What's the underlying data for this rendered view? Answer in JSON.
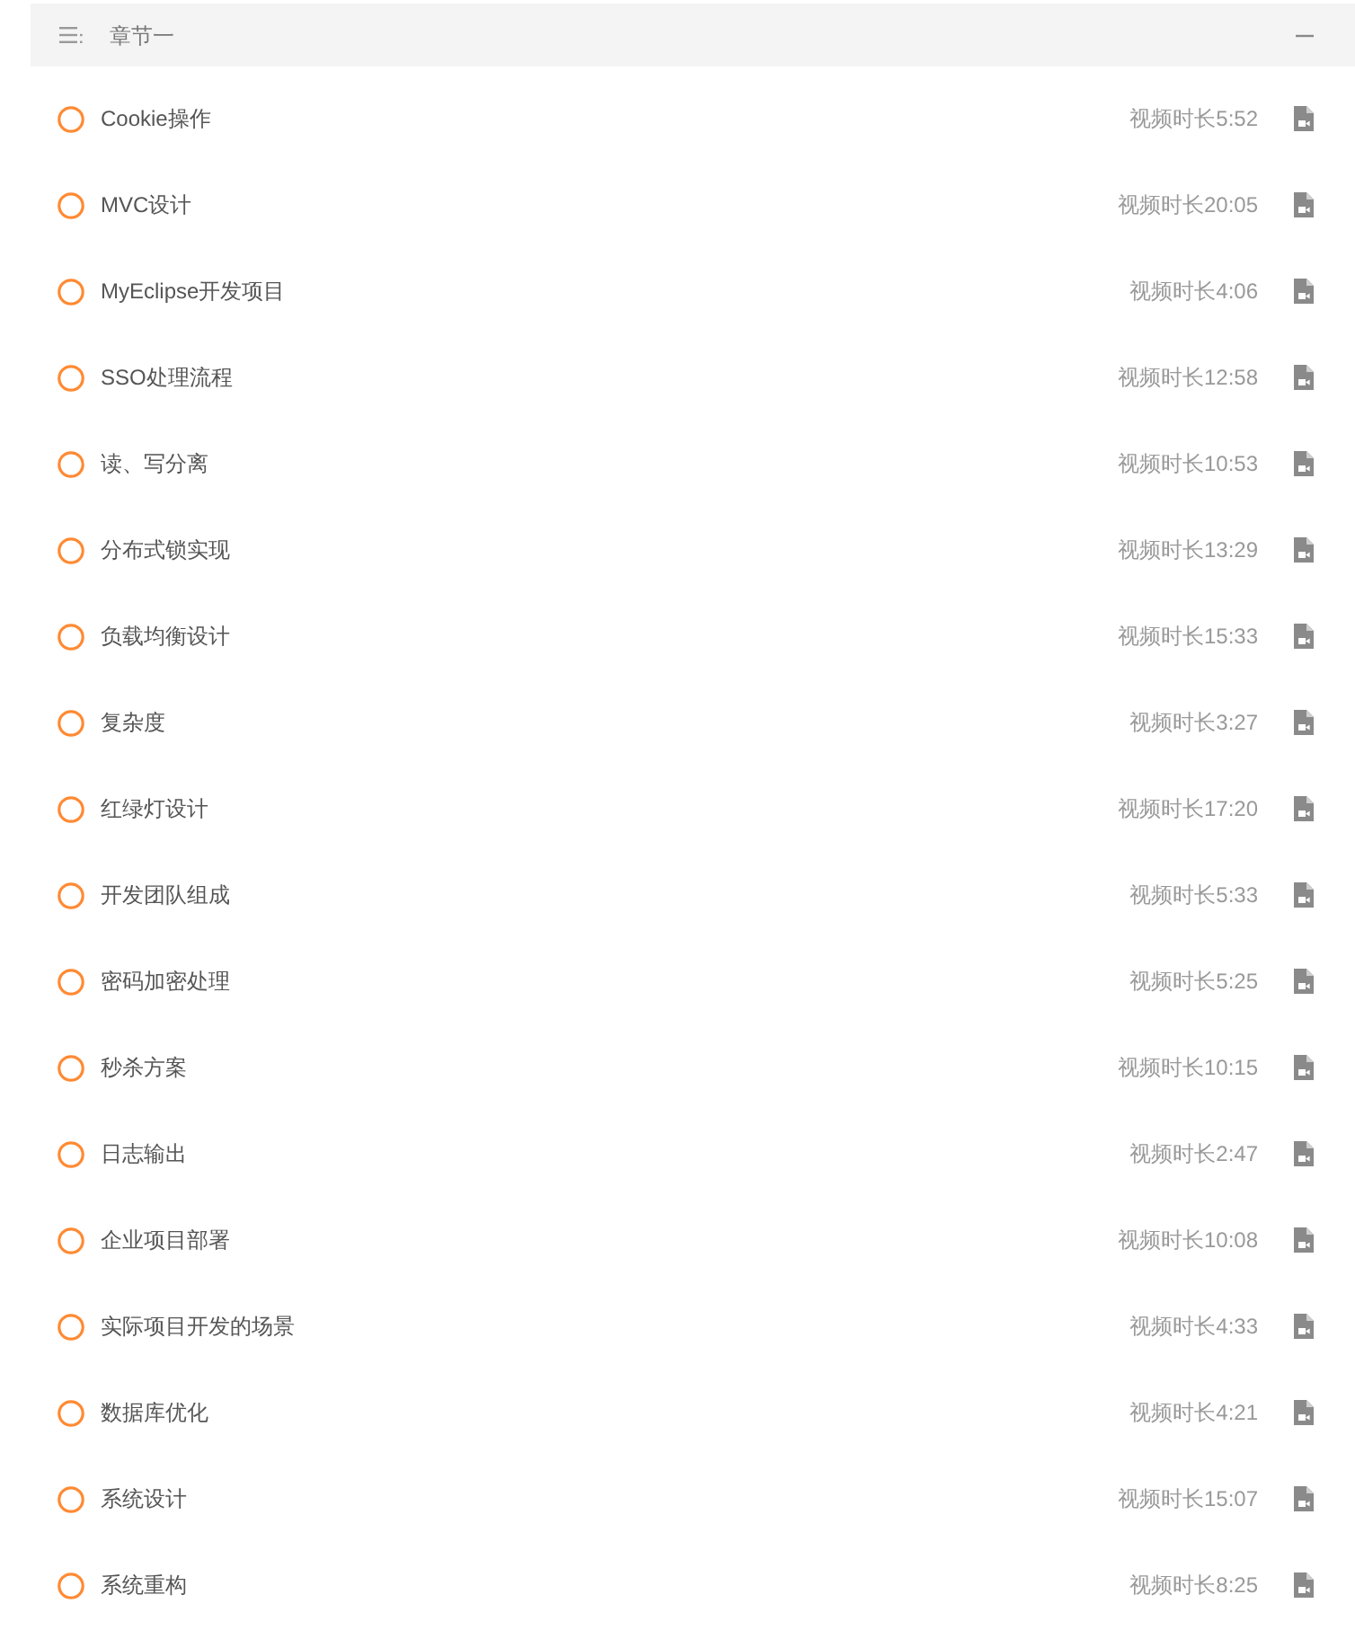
{
  "chapter": {
    "title": "章节一",
    "expanded": true
  },
  "lessons": [
    {
      "title": "Cookie操作",
      "duration": "视频时长5:52"
    },
    {
      "title": "MVC设计",
      "duration": "视频时长20:05"
    },
    {
      "title": "MyEclipse开发项目",
      "duration": "视频时长4:06"
    },
    {
      "title": "SSO处理流程",
      "duration": "视频时长12:58"
    },
    {
      "title": "读、写分离",
      "duration": "视频时长10:53"
    },
    {
      "title": "分布式锁实现",
      "duration": "视频时长13:29"
    },
    {
      "title": "负载均衡设计",
      "duration": "视频时长15:33"
    },
    {
      "title": "复杂度",
      "duration": "视频时长3:27"
    },
    {
      "title": "红绿灯设计",
      "duration": "视频时长17:20"
    },
    {
      "title": "开发团队组成",
      "duration": "视频时长5:33"
    },
    {
      "title": "密码加密处理",
      "duration": "视频时长5:25"
    },
    {
      "title": "秒杀方案",
      "duration": "视频时长10:15"
    },
    {
      "title": "日志输出",
      "duration": "视频时长2:47"
    },
    {
      "title": "企业项目部署",
      "duration": "视频时长10:08"
    },
    {
      "title": "实际项目开发的场景",
      "duration": "视频时长4:33"
    },
    {
      "title": "数据库优化",
      "duration": "视频时长4:21"
    },
    {
      "title": "系统设计",
      "duration": "视频时长15:07"
    },
    {
      "title": "系统重构",
      "duration": "视频时长8:25"
    }
  ]
}
